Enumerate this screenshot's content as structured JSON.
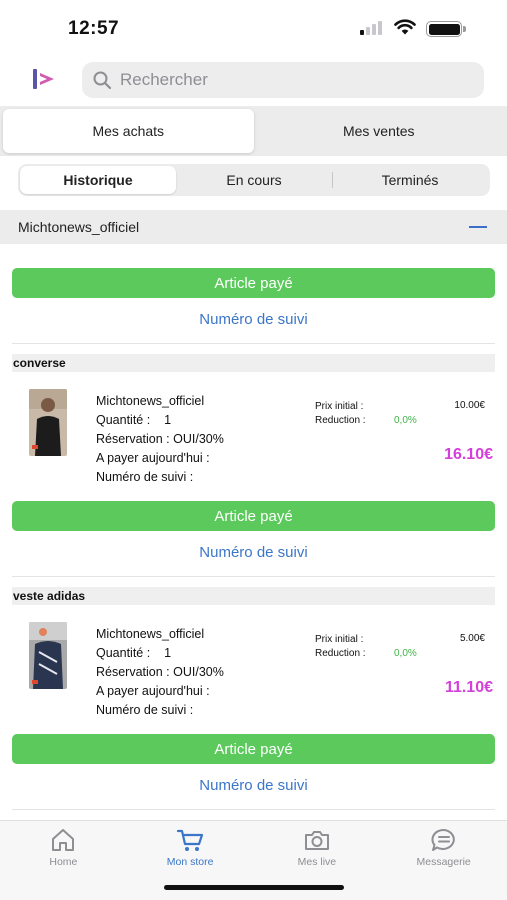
{
  "status_bar": {
    "time": "12:57"
  },
  "header": {
    "logo_icon": "app-logo-icon",
    "search": {
      "placeholder": "Rechercher",
      "value": ""
    }
  },
  "main_tabs": [
    {
      "label": "Mes achats",
      "active": true
    },
    {
      "label": "Mes ventes",
      "active": false
    }
  ],
  "sub_tabs": [
    {
      "label": "Historique",
      "active": true
    },
    {
      "label": "En cours",
      "active": false
    },
    {
      "label": "Terminés",
      "active": false
    }
  ],
  "seller_group": {
    "name": "Michtonews_officiel",
    "paid_label": "Article payé",
    "tracking_link": "Numéro de suivi"
  },
  "items": [
    {
      "title": "converse",
      "seller": "Michtonews_officiel",
      "quantity_label": "Quantité :",
      "quantity": "1",
      "reservation": "Réservation : OUI/30%",
      "to_pay_today": "A payer aujourd'hui :",
      "tracking_number": "Numéro de suivi :",
      "initial_price_label": "Prix initial :",
      "initial_price": "10.00€",
      "reduction_label": "Reduction :",
      "reduction": "0,0%",
      "total": "16.10€",
      "paid_label": "Article payé",
      "tracking_link": "Numéro de suivi"
    },
    {
      "title": "veste adidas",
      "seller": "Michtonews_officiel",
      "quantity_label": "Quantité :",
      "quantity": "1",
      "reservation": "Réservation : OUI/30%",
      "to_pay_today": "A payer aujourd'hui :",
      "tracking_number": "Numéro de suivi :",
      "initial_price_label": "Prix initial :",
      "initial_price": "5.00€",
      "reduction_label": "Reduction :",
      "reduction": "0,0%",
      "total": "11.10€",
      "paid_label": "Article payé",
      "tracking_link": "Numéro de suivi"
    }
  ],
  "bottom_nav": [
    {
      "label": "Home",
      "icon": "home-icon",
      "active": false
    },
    {
      "label": "Mon store",
      "icon": "cart-icon",
      "active": true
    },
    {
      "label": "Mes live",
      "icon": "camera-icon",
      "active": false
    },
    {
      "label": "Messagerie",
      "icon": "chat-icon",
      "active": false
    }
  ],
  "colors": {
    "accent_blue": "#3b76c9",
    "paid_green": "#5bc95b",
    "total_magenta": "#d43fd9",
    "reduction_green": "#3fb24a"
  }
}
